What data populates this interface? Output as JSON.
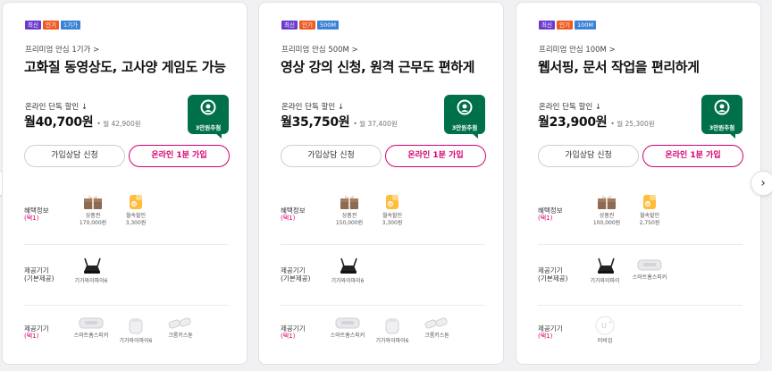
{
  "colors": {
    "badge_new": "#6b3bd1",
    "badge_popular": "#f05a22",
    "badge_speed": "#3b82d6",
    "accent": "#d6006f",
    "promo": "#00704a"
  },
  "nav": {
    "prev_icon": "‹",
    "next_icon": "›"
  },
  "cards": [
    {
      "badges": [
        "최신",
        "인기",
        "1기가"
      ],
      "subtitle": "프리미엄 안심 1기가 >",
      "title": "고화질 동영상도, 고사양 게임도 가능",
      "discount_label": "온라인 단독 할인 ↓",
      "price": "월40,700원",
      "original_price": "• 월 42,900원",
      "promo": "3만원추첨",
      "consult_button": "가입상담 신청",
      "join_button": "온라인 1분 가입",
      "benefit": {
        "label": "혜택정보",
        "mark": "(택1)",
        "items": [
          {
            "icon": "gift-box",
            "name": "상품권",
            "value": "170,000원"
          },
          {
            "icon": "won-coin",
            "name": "월속할인",
            "value": "3,300원"
          }
        ]
      },
      "device": {
        "label": "제공기기",
        "sub": "(기본제공)",
        "items": [
          {
            "icon": "router",
            "name": "기가와이파이6"
          }
        ]
      },
      "option": {
        "label": "제공기기",
        "mark": "(택1)",
        "items": [
          {
            "icon": "smart-speaker",
            "name": "스마트홈스피커"
          },
          {
            "icon": "mesh-wifi",
            "name": "기가와이파이6"
          },
          {
            "icon": "plug-pair",
            "name": "크롬키스톤"
          }
        ]
      }
    },
    {
      "badges": [
        "최신",
        "인기",
        "500M"
      ],
      "subtitle": "프리미엄 안심 500M >",
      "title": "영상 강의 신청, 원격 근무도 편하게",
      "discount_label": "온라인 단독 할인 ↓",
      "price": "월35,750원",
      "original_price": "• 월 37,400원",
      "promo": "3만원추첨",
      "consult_button": "가입상담 신청",
      "join_button": "온라인 1분 가입",
      "benefit": {
        "label": "혜택정보",
        "mark": "(택1)",
        "items": [
          {
            "icon": "gift-box",
            "name": "상품권",
            "value": "150,000원"
          },
          {
            "icon": "won-coin",
            "name": "월속할인",
            "value": "3,300원"
          }
        ]
      },
      "device": {
        "label": "제공기기",
        "sub": "(기본제공)",
        "items": [
          {
            "icon": "router",
            "name": "기가와이파이6"
          }
        ]
      },
      "option": {
        "label": "제공기기",
        "mark": "(택1)",
        "items": [
          {
            "icon": "smart-speaker",
            "name": "스마트홈스피커"
          },
          {
            "icon": "mesh-wifi",
            "name": "기가와이파이6"
          },
          {
            "icon": "plug-pair",
            "name": "크롬키스톤"
          }
        ]
      }
    },
    {
      "badges": [
        "최신",
        "인기",
        "100M"
      ],
      "subtitle": "프리미엄 안심 100M >",
      "title": "웹서핑, 문서 작업을 편리하게",
      "discount_label": "온라인 단독 할인 ↓",
      "price": "월23,900원",
      "original_price": "• 월 25,300원",
      "promo": "3만원추첨",
      "consult_button": "가입상담 신청",
      "join_button": "온라인 1분 가입",
      "benefit": {
        "label": "혜택정보",
        "mark": "(택1)",
        "items": [
          {
            "icon": "gift-box",
            "name": "상품권",
            "value": "100,000원"
          },
          {
            "icon": "won-coin",
            "name": "월속할인",
            "value": "2,750원"
          }
        ]
      },
      "device": {
        "label": "제공기기",
        "sub": "(기본제공)",
        "items": [
          {
            "icon": "router",
            "name": "기가와이파이"
          },
          {
            "icon": "smart-speaker",
            "name": "스마트홈스피커"
          }
        ]
      },
      "option": {
        "label": "제공기기",
        "mark": "(택1)",
        "items": [
          {
            "icon": "u-plus-mark",
            "name": "미비검"
          }
        ]
      }
    }
  ]
}
